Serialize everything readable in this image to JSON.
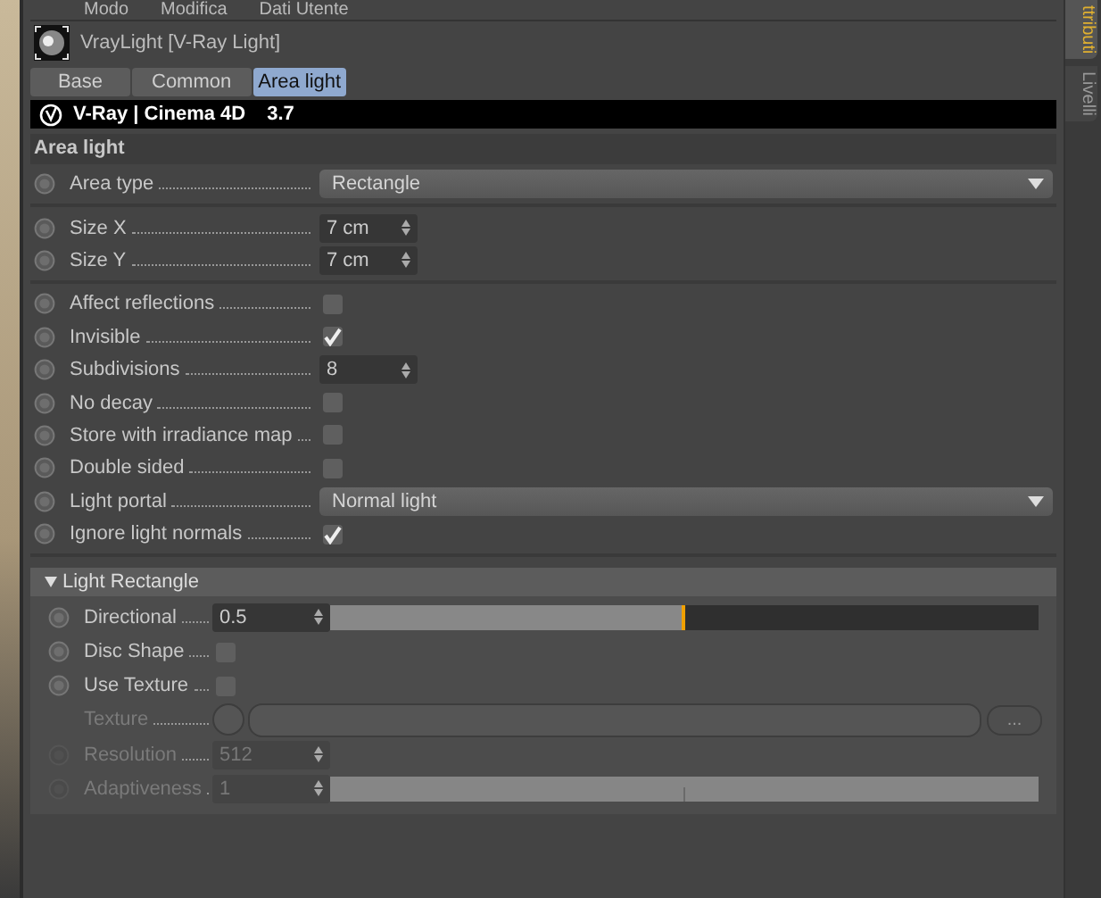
{
  "menu": [
    "Modo",
    "Modifica",
    "Dati Utente"
  ],
  "object": {
    "title": "VrayLight [V-Ray Light]"
  },
  "tabs": [
    {
      "label": "Base",
      "selected": false
    },
    {
      "label": "Common",
      "selected": false
    },
    {
      "label": "Area light",
      "selected": true
    }
  ],
  "banner": {
    "product": "V-Ray | Cinema 4D",
    "version": "3.7"
  },
  "section": {
    "title": "Area light",
    "groups": [
      [
        {
          "kind": "dropdown",
          "label": "Area type",
          "value": "Rectangle"
        }
      ],
      [
        {
          "kind": "number",
          "label": "Size X",
          "value": "7 cm"
        },
        {
          "kind": "number",
          "label": "Size Y",
          "value": "7 cm"
        }
      ],
      [
        {
          "kind": "checkbox",
          "label": "Affect reflections",
          "checked": false
        },
        {
          "kind": "checkbox",
          "label": "Invisible",
          "checked": true
        },
        {
          "kind": "number",
          "label": "Subdivisions",
          "value": "8"
        },
        {
          "kind": "checkbox",
          "label": "No decay",
          "checked": false
        },
        {
          "kind": "checkbox",
          "label": "Store with irradiance map",
          "checked": false
        },
        {
          "kind": "checkbox",
          "label": "Double sided",
          "checked": false
        },
        {
          "kind": "dropdown",
          "label": "Light portal",
          "value": "Normal light"
        },
        {
          "kind": "checkbox",
          "label": "Ignore light normals",
          "checked": true
        }
      ]
    ]
  },
  "subsection": {
    "title": "Light Rectangle",
    "expanded": true,
    "params": [
      {
        "kind": "slider",
        "label": "Directional",
        "value": "0.5",
        "level": 0.5,
        "disabled": false
      },
      {
        "kind": "checkbox",
        "label": "Disc Shape",
        "checked": false,
        "disabled": false
      },
      {
        "kind": "checkbox",
        "label": "Use Texture",
        "checked": false,
        "disabled": false
      },
      {
        "kind": "texture",
        "label": "Texture",
        "button": "...",
        "disabled": true
      },
      {
        "kind": "number",
        "label": "Resolution",
        "value": "512",
        "disabled": true
      },
      {
        "kind": "slider",
        "label": "Adaptiveness",
        "value": "1",
        "level": 0.5,
        "disabled": true
      }
    ]
  },
  "side_tabs": [
    {
      "label": "ttributi",
      "selected": true
    },
    {
      "label": "Livelli",
      "selected": false
    }
  ]
}
